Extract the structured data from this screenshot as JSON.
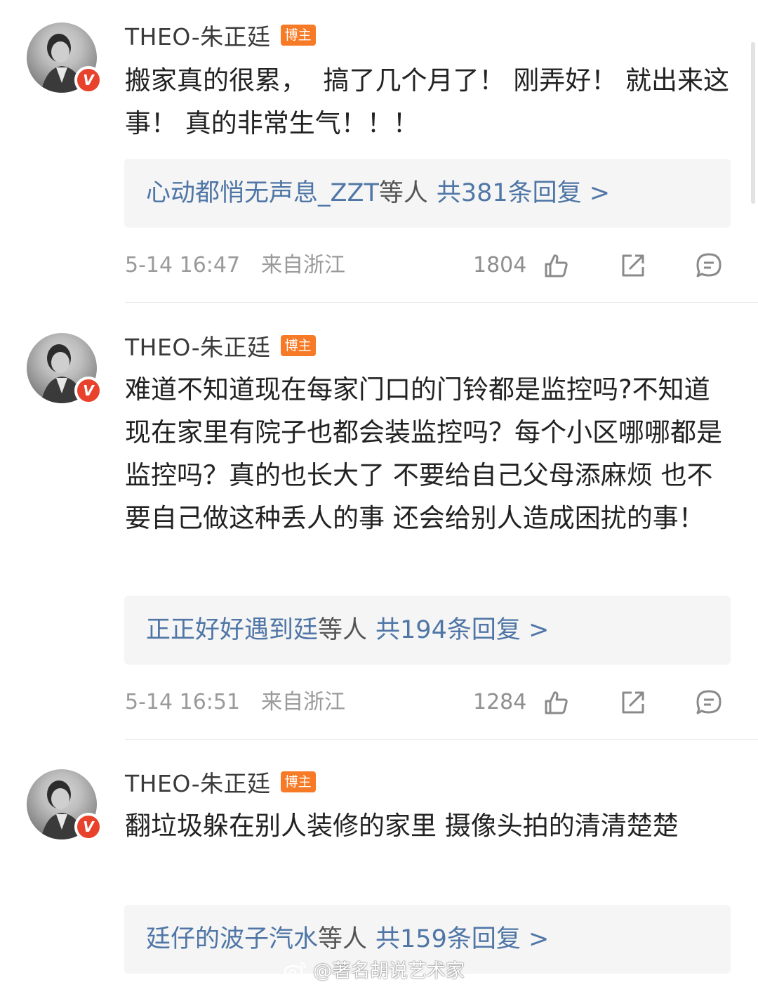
{
  "colors": {
    "username": "#3a3a3a",
    "tag_bg": "#f77b27",
    "verified_badge": "#e8412c",
    "reply_link": "#4f76a6",
    "meta_text": "#9a9a9a",
    "reply_box_bg": "#f5f5f5"
  },
  "comments": [
    {
      "username": "THEO-朱正廷",
      "tag": "博主",
      "verified_badge": "V",
      "text": "搬家真的很累，  搞了几个月了！ 刚弄好！ 就出来这事！ 真的非常生气！！！",
      "reply_users": "心动都悄无声息_ZZT",
      "reply_others": "等人",
      "reply_count": "共381条回复 >",
      "time": "5-14 16:47",
      "location": "来自浙江",
      "likes": "1804",
      "icons": [
        "like-icon",
        "share-icon",
        "comment-icon"
      ]
    },
    {
      "username": "THEO-朱正廷",
      "tag": "博主",
      "verified_badge": "V",
      "text": "难道不知道现在每家门口的门铃都是监控吗?不知道现在家里有院子也都会装监控吗？每个小区哪哪都是监控吗？真的也长大了 不要给自己父母添麻烦 也不要自己做这种丢人的事 还会给别人造成困扰的事！",
      "reply_users": "正正好好遇到廷",
      "reply_others": "等人",
      "reply_count": "共194条回复 >",
      "time": "5-14 16:51",
      "location": "来自浙江",
      "likes": "1284",
      "icons": [
        "like-icon",
        "share-icon",
        "comment-icon"
      ]
    },
    {
      "username": "THEO-朱正廷",
      "tag": "博主",
      "verified_badge": "V",
      "text": "翻垃圾躲在别人装修的家里 摄像头拍的清清楚楚",
      "reply_users": "廷仔的波子汽水",
      "reply_others": "等人",
      "reply_count": "共159条回复 >",
      "time": "",
      "location": "",
      "likes": "",
      "icons": []
    }
  ],
  "watermark": "@著名胡说艺术家"
}
